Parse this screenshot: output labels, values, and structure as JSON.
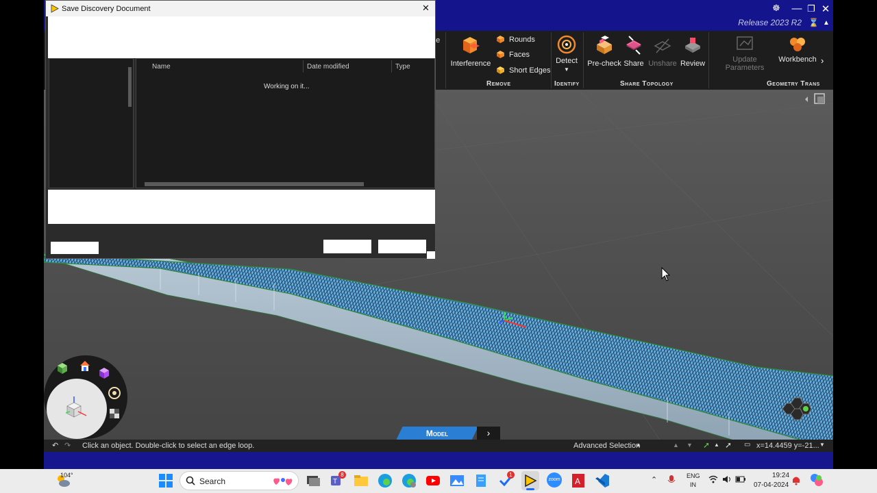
{
  "dialog": {
    "title": "Save Discovery Document",
    "close": "✕",
    "columns": [
      "Name",
      "Date modified",
      "Type"
    ],
    "loading_text": "Working on it..."
  },
  "app": {
    "release": "Release 2023 R2",
    "ribbon_partial_label": "ne",
    "ribbon": {
      "remove": {
        "label": "Remove",
        "interference": "Interference",
        "rounds": "Rounds",
        "faces": "Faces",
        "short_edges": "Short Edges"
      },
      "identify": {
        "label": "Identify",
        "detect": "Detect"
      },
      "share_topology": {
        "label": "Share Topology",
        "precheck": "Pre-check",
        "share": "Share",
        "unshare": "Unshare",
        "review": "Review"
      },
      "geometry": {
        "label": "Geometry Trans",
        "update_parameters": "Update Parameters",
        "workbench": "Workbench"
      }
    },
    "mode_tab": "Model",
    "status": {
      "hint": "Click an object. Double-click to select an edge loop.",
      "selection_mode": "Advanced Selection",
      "coords": "x=14.4459  y=-21..."
    }
  },
  "taskbar": {
    "weather": "104°",
    "search_placeholder": "Search",
    "teams_badge": "8",
    "todo_badge": "1",
    "zoom_label": "zoom",
    "lang_top": "ENG",
    "lang_bottom": "IN",
    "time": "19:24",
    "date": "07-04-2024"
  },
  "colors": {
    "titlebar": "#14148c",
    "mesh": "#62aee0",
    "ribbon": "#1d1d1d"
  }
}
